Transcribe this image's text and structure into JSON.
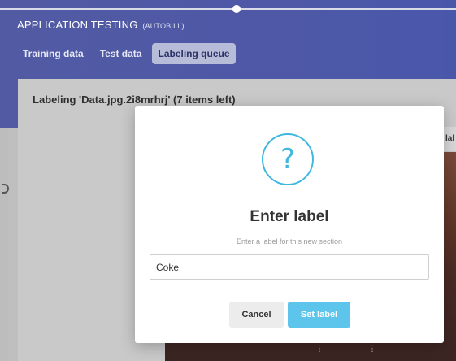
{
  "app": {
    "title": "APPLICATION TESTING",
    "title_suffix": "(AUTOBILL)"
  },
  "tabs": [
    {
      "label": "Training data",
      "active": false
    },
    {
      "label": "Test data",
      "active": false
    },
    {
      "label": "Labeling queue",
      "active": true
    }
  ],
  "panel": {
    "title": "Labeling 'Data.jpg.2i8mrhrj' (7 items left)",
    "side_label": "lal"
  },
  "modal": {
    "icon": "question-icon",
    "icon_glyph": "?",
    "title": "Enter label",
    "subtitle": "Enter a label for this new section",
    "input_value": "Coke",
    "cancel_label": "Cancel",
    "submit_label": "Set label"
  },
  "colors": {
    "header": "#4e58a6",
    "accent": "#3fb8e0",
    "primary_button": "#5dc5ec",
    "active_tab": "#b7bcd9"
  }
}
